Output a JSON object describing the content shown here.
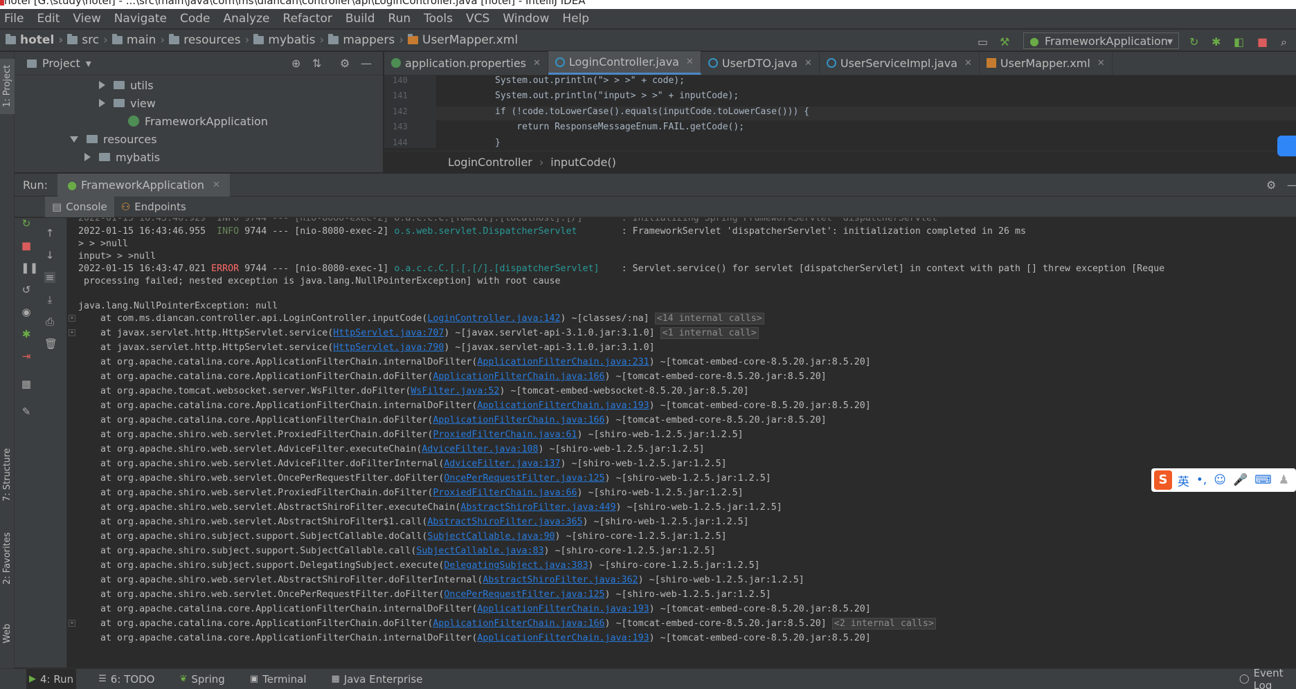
{
  "window": {
    "title": "hotel [G:\\study\\hotel] - ...\\src\\main\\java\\com\\ms\\diancan\\controller\\api\\LoginController.java [hotel] - IntelliJ IDEA"
  },
  "menu": [
    "File",
    "Edit",
    "View",
    "Navigate",
    "Code",
    "Analyze",
    "Refactor",
    "Build",
    "Run",
    "Tools",
    "VCS",
    "Window",
    "Help"
  ],
  "breadcrumbs": [
    "hotel",
    "src",
    "main",
    "resources",
    "mybatis",
    "mappers",
    "UserMapper.xml"
  ],
  "run_config": "FrameworkApplication",
  "project": {
    "title": "Project",
    "items": [
      "utils",
      "view",
      "FrameworkApplication",
      "resources",
      "mybatis"
    ]
  },
  "editor": {
    "tabs": [
      "application.properties",
      "LoginController.java",
      "UserDTO.java",
      "UserServiceImpl.java",
      "UserMapper.xml"
    ],
    "line_numbers": [
      "140",
      "141",
      "142",
      "143",
      "144"
    ],
    "lines": [
      "System.out.println(\"> > >\" + code);",
      "System.out.println(\"input> > >\" + inputCode);",
      "if (!code.toLowerCase().equals(inputCode.toLowerCase())) {",
      "    return ResponseMessageEnum.FAIL.getCode();",
      "}"
    ],
    "breadcrumb": [
      "LoginController",
      "inputCode()"
    ]
  },
  "run": {
    "label": "Run:",
    "tab": "FrameworkApplication",
    "subtabs": [
      "Console",
      "Endpoints"
    ]
  },
  "console": {
    "info_line": {
      "ts": "2022-01-15 16:43:46.955",
      "level": "INFO",
      "pid": "9744 --- [nio-8080-exec-2]",
      "logger": "o.s.web.servlet.DispatcherServlet",
      "msg": ": FrameworkServlet 'dispatcherServlet': initialization completed in 26 ms"
    },
    "plain1": "> > >null",
    "plain2": "input> > >null",
    "error_line": {
      "ts": "2022-01-15 16:43:47.021",
      "level": "ERROR",
      "pid": "9744 --- [nio-8080-exec-1]",
      "logger": "o.a.c.c.C.[.[.[/].[dispatcherServlet]",
      "msg": ": Servlet.service() for servlet [dispatcherServlet] in context with path [] threw exception [Reque"
    },
    "error_cont": " processing failed; nested exception is java.lang.NullPointerException] with root cause",
    "exception": "java.lang.NullPointerException: null",
    "stack": [
      {
        "pre": "at com.ms.diancan.controller.api.LoginController.inputCode(",
        "link": "LoginController.java:142",
        "post": ") ~[classes/:na]",
        "badge": "<14 internal calls>"
      },
      {
        "pre": "at javax.servlet.http.HttpServlet.service(",
        "link": "HttpServlet.java:707",
        "post": ") ~[javax.servlet-api-3.1.0.jar:3.1.0]",
        "badge": "<1 internal call>"
      },
      {
        "pre": "at javax.servlet.http.HttpServlet.service(",
        "link": "HttpServlet.java:790",
        "post": ") ~[javax.servlet-api-3.1.0.jar:3.1.0]",
        "badge": ""
      },
      {
        "pre": "at org.apache.catalina.core.ApplicationFilterChain.internalDoFilter(",
        "link": "ApplicationFilterChain.java:231",
        "post": ") ~[tomcat-embed-core-8.5.20.jar:8.5.20]",
        "badge": ""
      },
      {
        "pre": "at org.apache.catalina.core.ApplicationFilterChain.doFilter(",
        "link": "ApplicationFilterChain.java:166",
        "post": ") ~[tomcat-embed-core-8.5.20.jar:8.5.20]",
        "badge": ""
      },
      {
        "pre": "at org.apache.tomcat.websocket.server.WsFilter.doFilter(",
        "link": "WsFilter.java:52",
        "post": ") ~[tomcat-embed-websocket-8.5.20.jar:8.5.20]",
        "badge": ""
      },
      {
        "pre": "at org.apache.catalina.core.ApplicationFilterChain.internalDoFilter(",
        "link": "ApplicationFilterChain.java:193",
        "post": ") ~[tomcat-embed-core-8.5.20.jar:8.5.20]",
        "badge": ""
      },
      {
        "pre": "at org.apache.catalina.core.ApplicationFilterChain.doFilter(",
        "link": "ApplicationFilterChain.java:166",
        "post": ") ~[tomcat-embed-core-8.5.20.jar:8.5.20]",
        "badge": ""
      },
      {
        "pre": "at org.apache.shiro.web.servlet.ProxiedFilterChain.doFilter(",
        "link": "ProxiedFilterChain.java:61",
        "post": ") ~[shiro-web-1.2.5.jar:1.2.5]",
        "badge": ""
      },
      {
        "pre": "at org.apache.shiro.web.servlet.AdviceFilter.executeChain(",
        "link": "AdviceFilter.java:108",
        "post": ") ~[shiro-web-1.2.5.jar:1.2.5]",
        "badge": ""
      },
      {
        "pre": "at org.apache.shiro.web.servlet.AdviceFilter.doFilterInternal(",
        "link": "AdviceFilter.java:137",
        "post": ") ~[shiro-web-1.2.5.jar:1.2.5]",
        "badge": ""
      },
      {
        "pre": "at org.apache.shiro.web.servlet.OncePerRequestFilter.doFilter(",
        "link": "OncePerRequestFilter.java:125",
        "post": ") ~[shiro-web-1.2.5.jar:1.2.5]",
        "badge": ""
      },
      {
        "pre": "at org.apache.shiro.web.servlet.ProxiedFilterChain.doFilter(",
        "link": "ProxiedFilterChain.java:66",
        "post": ") ~[shiro-web-1.2.5.jar:1.2.5]",
        "badge": ""
      },
      {
        "pre": "at org.apache.shiro.web.servlet.AbstractShiroFilter.executeChain(",
        "link": "AbstractShiroFilter.java:449",
        "post": ") ~[shiro-web-1.2.5.jar:1.2.5]",
        "badge": ""
      },
      {
        "pre": "at org.apache.shiro.web.servlet.AbstractShiroFilter$1.call(",
        "link": "AbstractShiroFilter.java:365",
        "post": ") ~[shiro-web-1.2.5.jar:1.2.5]",
        "badge": ""
      },
      {
        "pre": "at org.apache.shiro.subject.support.SubjectCallable.doCall(",
        "link": "SubjectCallable.java:90",
        "post": ") ~[shiro-core-1.2.5.jar:1.2.5]",
        "badge": ""
      },
      {
        "pre": "at org.apache.shiro.subject.support.SubjectCallable.call(",
        "link": "SubjectCallable.java:83",
        "post": ") ~[shiro-core-1.2.5.jar:1.2.5]",
        "badge": ""
      },
      {
        "pre": "at org.apache.shiro.subject.support.DelegatingSubject.execute(",
        "link": "DelegatingSubject.java:383",
        "post": ") ~[shiro-core-1.2.5.jar:1.2.5]",
        "badge": ""
      },
      {
        "pre": "at org.apache.shiro.web.servlet.AbstractShiroFilter.doFilterInternal(",
        "link": "AbstractShiroFilter.java:362",
        "post": ") ~[shiro-web-1.2.5.jar:1.2.5]",
        "badge": ""
      },
      {
        "pre": "at org.apache.shiro.web.servlet.OncePerRequestFilter.doFilter(",
        "link": "OncePerRequestFilter.java:125",
        "post": ") ~[shiro-web-1.2.5.jar:1.2.5]",
        "badge": ""
      },
      {
        "pre": "at org.apache.catalina.core.ApplicationFilterChain.internalDoFilter(",
        "link": "ApplicationFilterChain.java:193",
        "post": ") ~[tomcat-embed-core-8.5.20.jar:8.5.20]",
        "badge": ""
      },
      {
        "pre": "at org.apache.catalina.core.ApplicationFilterChain.doFilter(",
        "link": "ApplicationFilterChain.java:166",
        "post": ") ~[tomcat-embed-core-8.5.20.jar:8.5.20]",
        "badge": "<2 internal calls>"
      },
      {
        "pre": "at org.apache.catalina.core.ApplicationFilterChain.internalDoFilter(",
        "link": "ApplicationFilterChain.java:193",
        "post": ") ~[tomcat-embed-core-8.5.20.jar:8.5.20]",
        "badge": ""
      }
    ]
  },
  "bottom_tabs": [
    "4: Run",
    "6: TODO",
    "Spring",
    "Terminal",
    "Java Enterprise"
  ],
  "event_log": "Event Log",
  "left_stripe": [
    "1: Project",
    "7: Structure",
    "2: Favorites",
    "Web"
  ],
  "ime": {
    "lang": "英"
  },
  "colors": {
    "accent": "#4a88c7",
    "error": "#ff6b68",
    "info": "#6a8759",
    "link": "#287bde",
    "logger": "#299999"
  }
}
